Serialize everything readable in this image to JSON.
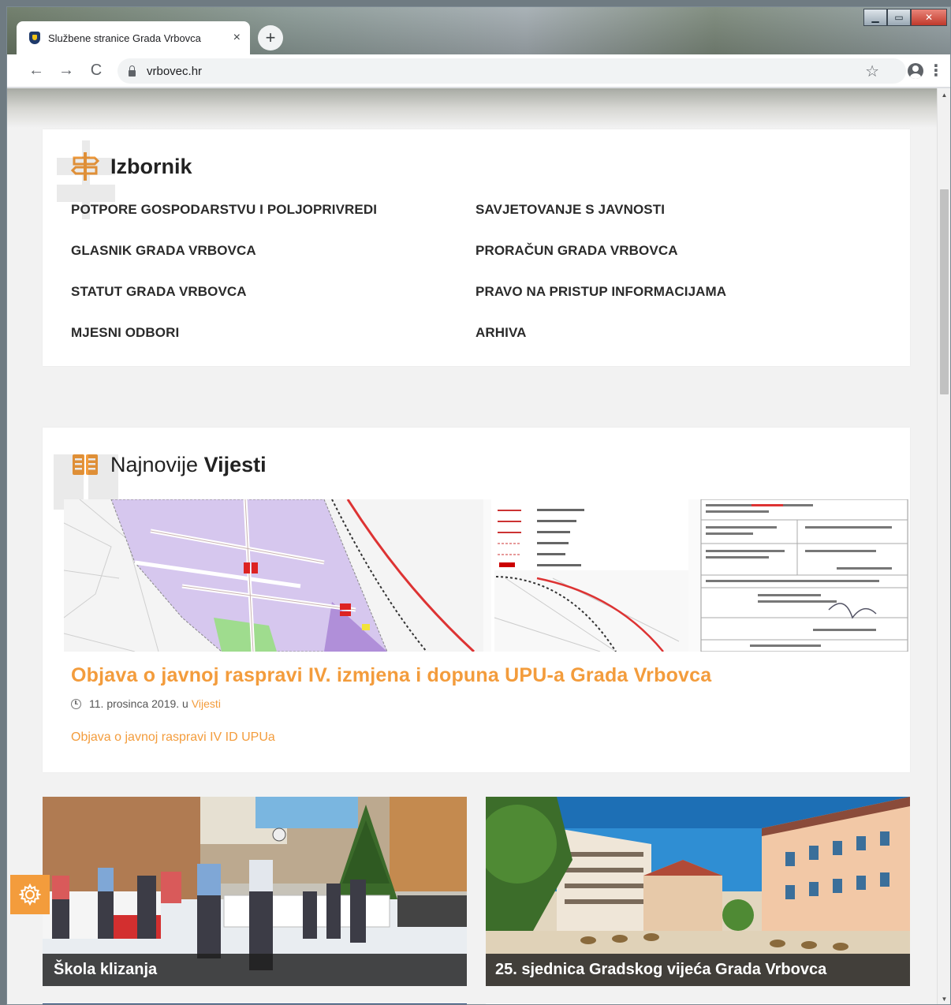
{
  "browser": {
    "tab_title": "Službene stranice Grada Vrbovca",
    "tab_close": "×",
    "new_tab": "+",
    "url": "vrbovec.hr",
    "back": "←",
    "forward": "→",
    "reload": "C",
    "star": "☆",
    "menu": "⋮",
    "window_controls": {
      "minimize": "▁",
      "maximize": "▭",
      "close": "✕"
    }
  },
  "menu_section": {
    "title": "Izbornik",
    "icon": "signpost-icon",
    "links": [
      "POTPORE GOSPODARSTVU I POLJOPRIVREDI",
      "SAVJETOVANJE S JAVNOSTI",
      "GLASNIK GRADA VRBOVCA",
      "PRORAČUN GRADA VRBOVCA",
      "STATUT GRADA VRBOVCA",
      "PRAVO NA PRISTUP INFORMACIJAMA",
      "MJESNI ODBORI",
      "ARHIVA"
    ]
  },
  "news_section": {
    "title_light": "Najnovije",
    "title_bold": "Vijesti",
    "icon": "open-book-icon",
    "featured": {
      "title": "Objava o javnoj raspravi IV. izmjena i dopuna UPU-a Grada Vrbovca",
      "date": "11. prosinca 2019. u",
      "category": "Vijesti",
      "excerpt": "Objava o javnoj raspravi IV ID UPUa"
    },
    "tiles": [
      {
        "caption": "Škola klizanja"
      },
      {
        "caption": "25. sjednica Gradskog vijeća Grada Vrbovca"
      }
    ]
  },
  "colors": {
    "accent": "#f39c3c",
    "heading": "#222222",
    "page_bg": "#f2f2f2"
  }
}
